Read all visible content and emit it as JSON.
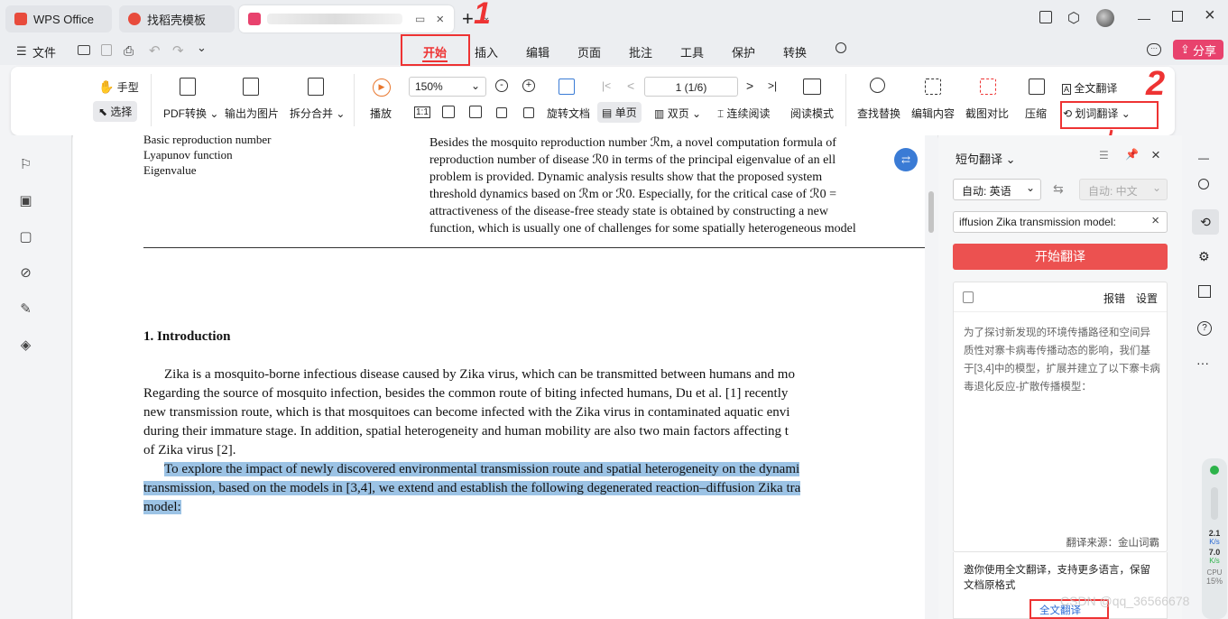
{
  "tabs": [
    {
      "label": "WPS Office",
      "color": "#e84b3c"
    },
    {
      "label": "找稻壳模板",
      "color": "#e84b3c"
    },
    {
      "label": "",
      "color": "#e8426d"
    }
  ],
  "menu": {
    "file": "文件",
    "items": [
      "开始",
      "插入",
      "编辑",
      "页面",
      "批注",
      "工具",
      "保护",
      "转换"
    ],
    "share": "分享"
  },
  "annotations": {
    "mark1": "1",
    "mark2": "2"
  },
  "ribbon": {
    "hand": "手型",
    "select": "选择",
    "pdf_convert": "PDF转换",
    "export_image": "输出为图片",
    "split_merge": "拆分合并",
    "play": "播放",
    "zoom": "150%",
    "page": "1 (1/6)",
    "rotate": "旋转文档",
    "single": "单页",
    "double": "双页",
    "continuous": "连续阅读",
    "reading_mode": "阅读模式",
    "find_replace": "查找替换",
    "edit_content": "编辑内容",
    "screenshot_compare": "截图对比",
    "compress": "压缩",
    "full_translate": "全文翻译",
    "word_translate": "划词翻译"
  },
  "document": {
    "keywords": [
      "Basic reproduction number",
      "Lyapunov function",
      "Eigenvalue"
    ],
    "abstract_lines": [
      "Besides the mosquito reproduction number ℛm, a novel computation formula of",
      "reproduction number of disease ℛ0 in terms of the principal eigenvalue of an ell",
      "problem is provided. Dynamic analysis results show that the proposed system",
      "threshold dynamics based on ℛm or ℛ0. Especially, for the critical case of ℛ0 =",
      "attractiveness of the disease-free steady state is obtained by constructing a new",
      "function, which is usually one of challenges for some spatially heterogeneous model"
    ],
    "section_title": "1.  Introduction",
    "body_lines": [
      "Zika is a mosquito-borne infectious disease caused by Zika virus, which can be transmitted between humans and mo",
      "Regarding the source of mosquito infection, besides the common route of biting infected humans, Du et al. [1] recently",
      "new transmission route, which is that mosquitoes can become infected with the Zika virus in contaminated aquatic envi",
      "during their immature stage. In addition, spatial heterogeneity and human mobility are also two main factors affecting t",
      "of Zika virus [2]."
    ],
    "highlight_lines": [
      "To explore the impact of newly discovered environmental transmission route and spatial heterogeneity on the dynami",
      "transmission, based on the models in [3,4], we extend and establish the following degenerated reaction–diffusion Zika tra",
      "model:"
    ]
  },
  "panel": {
    "title": "短句翻译",
    "source_lang": "自动: 英语",
    "target_lang": "自动: 中文",
    "input_value": "iffusion Zika transmission model:",
    "translate_button": "开始翻译",
    "report": "报错",
    "settings": "设置",
    "result": "为了探讨新发现的环境传播路径和空间异质性对寨卡病毒传播动态的影响，我们基于[3,4]中的模型，扩展并建立了以下寨卡病毒退化反应-扩散传播模型：",
    "source": "翻译来源：金山词霸",
    "promo": "邀你使用全文翻译，支持更多语言，保留文档原格式",
    "promo_link": "全文翻译"
  },
  "meter": {
    "up": "2.1",
    "up_unit": "K/s",
    "down": "7.0",
    "down_unit": "K/s",
    "cpu": "CPU",
    "cpu_val": "15%"
  },
  "watermark": "CSDN @qq_36566678"
}
